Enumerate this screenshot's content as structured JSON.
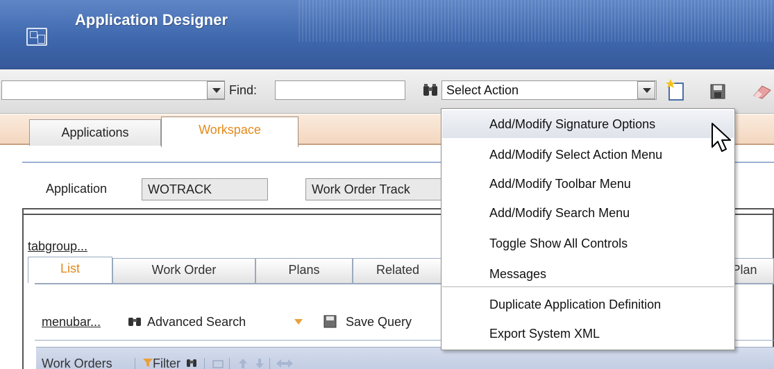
{
  "app": {
    "title": "Application Designer"
  },
  "toolbar": {
    "left_select_value": "",
    "find_label": "Find:",
    "find_value": "",
    "select_action_value": "Select Action",
    "icons": [
      "binoculars-icon",
      "new-record-icon",
      "save-icon",
      "clear-icon"
    ]
  },
  "tabs": [
    {
      "label": "Applications",
      "active": false
    },
    {
      "label": "Workspace",
      "active": true
    }
  ],
  "workspace": {
    "application_label": "Application",
    "application_value": "WOTRACK",
    "description_value": "Work Order Track"
  },
  "canvas": {
    "tabgroup_link": "tabgroup...",
    "subtabs": [
      {
        "label": "List",
        "active": true
      },
      {
        "label": "Work Order",
        "active": false
      },
      {
        "label": "Plans",
        "active": false
      },
      {
        "label": "Related",
        "active": false
      },
      {
        "label": "Plan",
        "active": false
      }
    ],
    "menubar_link": "menubar...",
    "advanced_search": "Advanced Search",
    "save_query": "Save Query",
    "table_title": "Work Orders",
    "filter_label": "Filter"
  },
  "dropdown": {
    "items": [
      {
        "label": "Add/Modify Signature Options",
        "hovered": true
      },
      {
        "label": "Add/Modify Select Action Menu",
        "hovered": false
      },
      {
        "label": "Add/Modify Toolbar Menu",
        "hovered": false
      },
      {
        "label": "Add/Modify Search Menu",
        "hovered": false
      },
      {
        "label": "Toggle Show All Controls",
        "hovered": false
      },
      {
        "label": "Messages",
        "hovered": false
      },
      {
        "label": "Duplicate Application Definition",
        "hovered": false
      },
      {
        "label": "Export System XML",
        "hovered": false
      }
    ]
  },
  "colors": {
    "title_bar": "#3f68ae",
    "active_tab_text": "#e28a1c",
    "tabstrip": "#f3d7c0",
    "table_header": "#c3cde3"
  }
}
